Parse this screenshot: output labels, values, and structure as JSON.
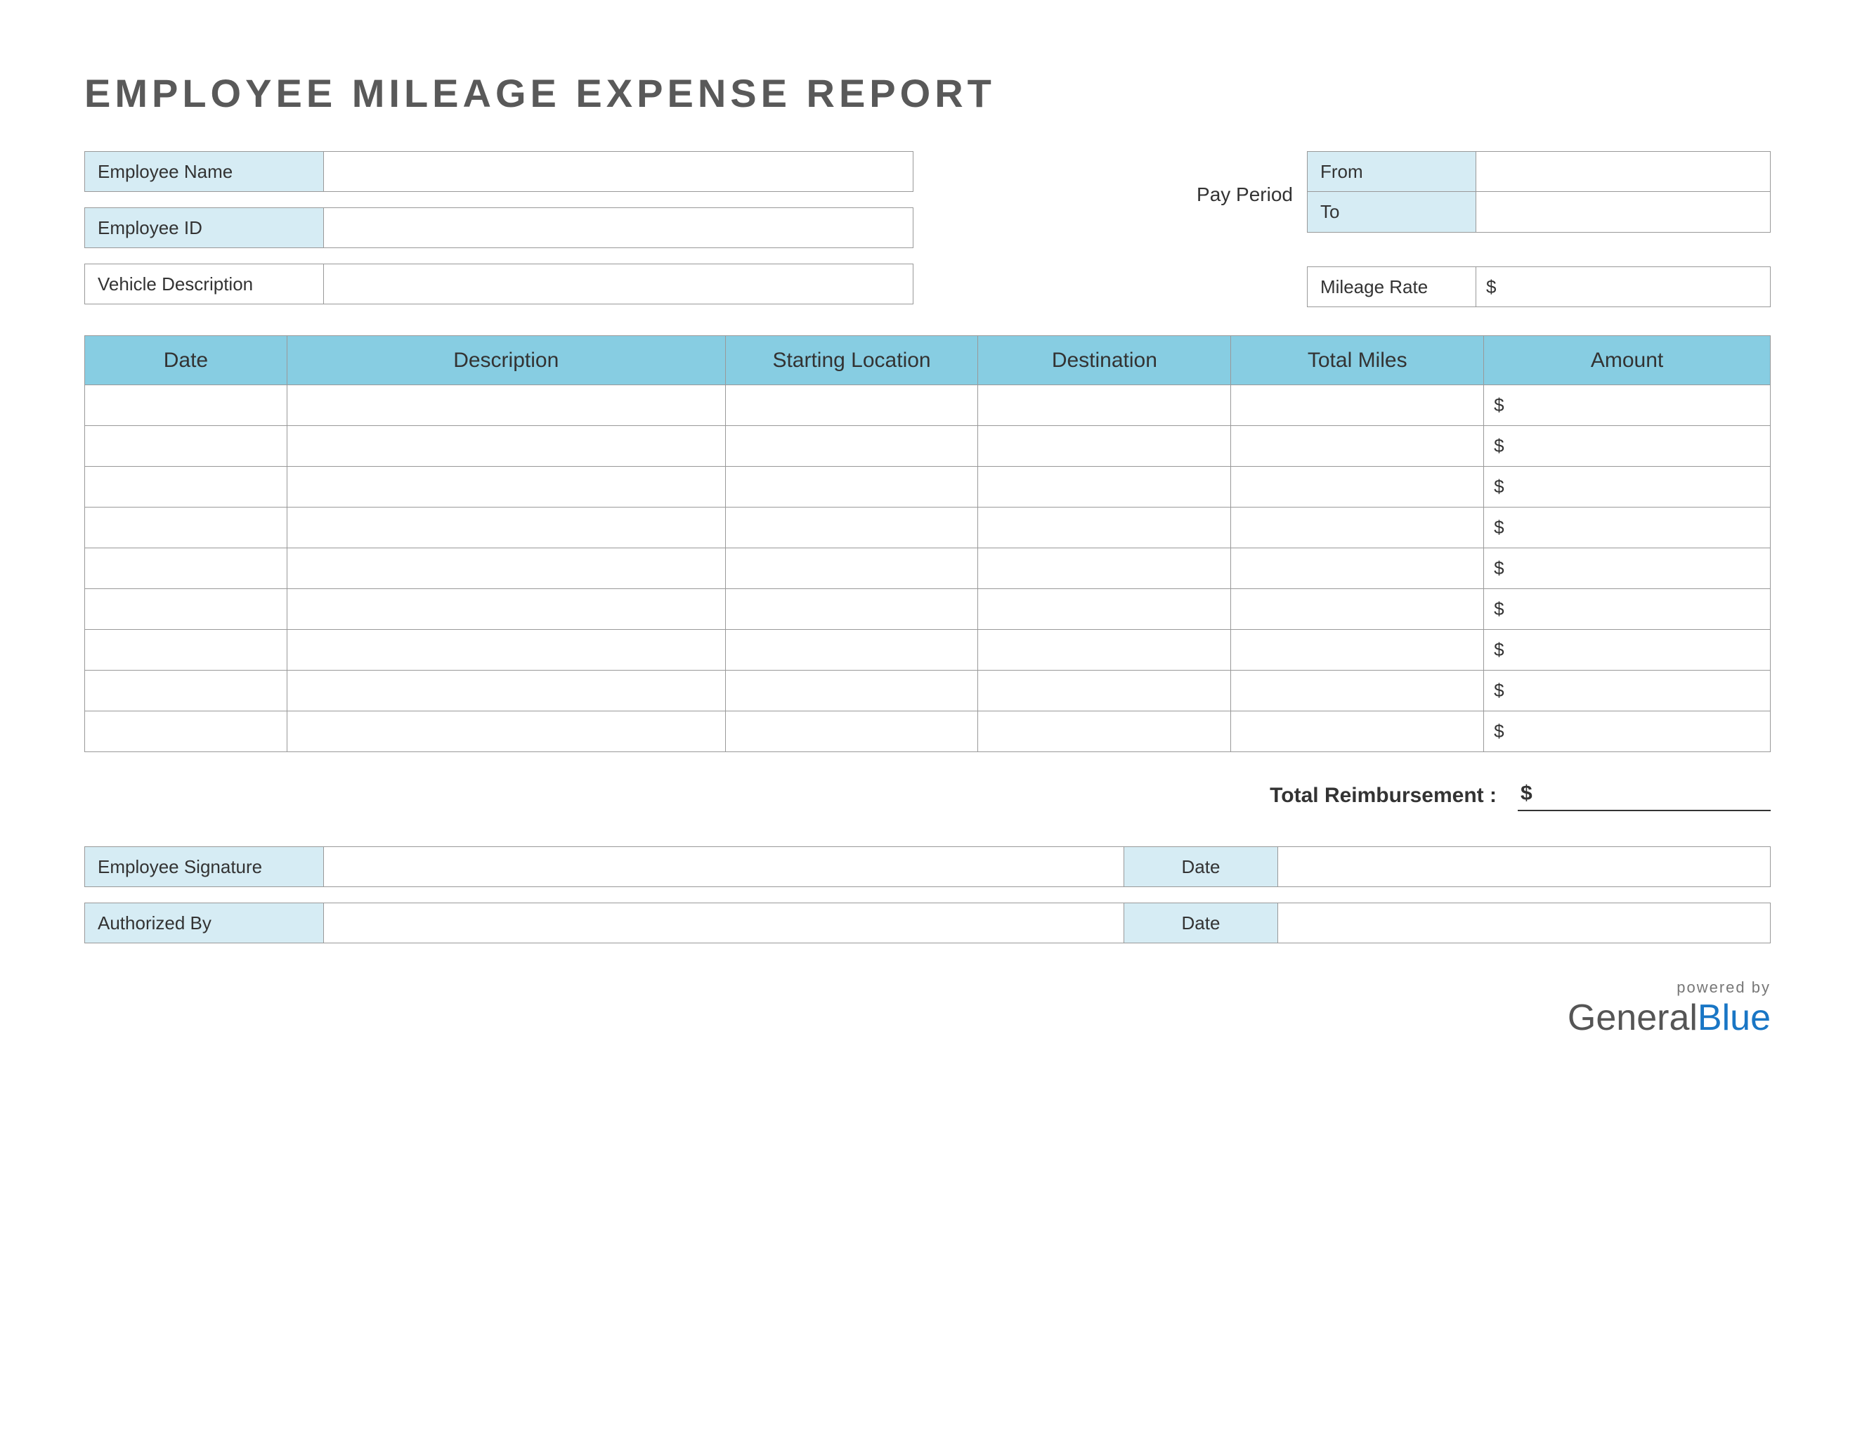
{
  "title": "EMPLOYEE MILEAGE EXPENSE REPORT",
  "fields": {
    "employee_name_label": "Employee Name",
    "employee_name_value": "",
    "employee_id_label": "Employee ID",
    "employee_id_value": "",
    "vehicle_desc_label": "Vehicle Description",
    "vehicle_desc_value": "",
    "pay_period_label": "Pay Period",
    "from_label": "From",
    "from_value": "",
    "to_label": "To",
    "to_value": "",
    "mileage_rate_label": "Mileage Rate",
    "mileage_rate_value": "$"
  },
  "table": {
    "headers": {
      "date": "Date",
      "description": "Description",
      "starting_location": "Starting Location",
      "destination": "Destination",
      "total_miles": "Total Miles",
      "amount": "Amount"
    },
    "rows": [
      {
        "date": "",
        "description": "",
        "starting_location": "",
        "destination": "",
        "total_miles": "",
        "amount": "$"
      },
      {
        "date": "",
        "description": "",
        "starting_location": "",
        "destination": "",
        "total_miles": "",
        "amount": "$"
      },
      {
        "date": "",
        "description": "",
        "starting_location": "",
        "destination": "",
        "total_miles": "",
        "amount": "$"
      },
      {
        "date": "",
        "description": "",
        "starting_location": "",
        "destination": "",
        "total_miles": "",
        "amount": "$"
      },
      {
        "date": "",
        "description": "",
        "starting_location": "",
        "destination": "",
        "total_miles": "",
        "amount": "$"
      },
      {
        "date": "",
        "description": "",
        "starting_location": "",
        "destination": "",
        "total_miles": "",
        "amount": "$"
      },
      {
        "date": "",
        "description": "",
        "starting_location": "",
        "destination": "",
        "total_miles": "",
        "amount": "$"
      },
      {
        "date": "",
        "description": "",
        "starting_location": "",
        "destination": "",
        "total_miles": "",
        "amount": "$"
      },
      {
        "date": "",
        "description": "",
        "starting_location": "",
        "destination": "",
        "total_miles": "",
        "amount": "$"
      }
    ]
  },
  "total": {
    "label": "Total Reimbursement :",
    "value": "$"
  },
  "signatures": {
    "employee_sig_label": "Employee Signature",
    "employee_sig_value": "",
    "employee_date_label": "Date",
    "employee_date_value": "",
    "authorized_label": "Authorized By",
    "authorized_value": "",
    "authorized_date_label": "Date",
    "authorized_date_value": ""
  },
  "footer": {
    "powered": "powered by",
    "brand_general": "General",
    "brand_blue": "Blue"
  }
}
